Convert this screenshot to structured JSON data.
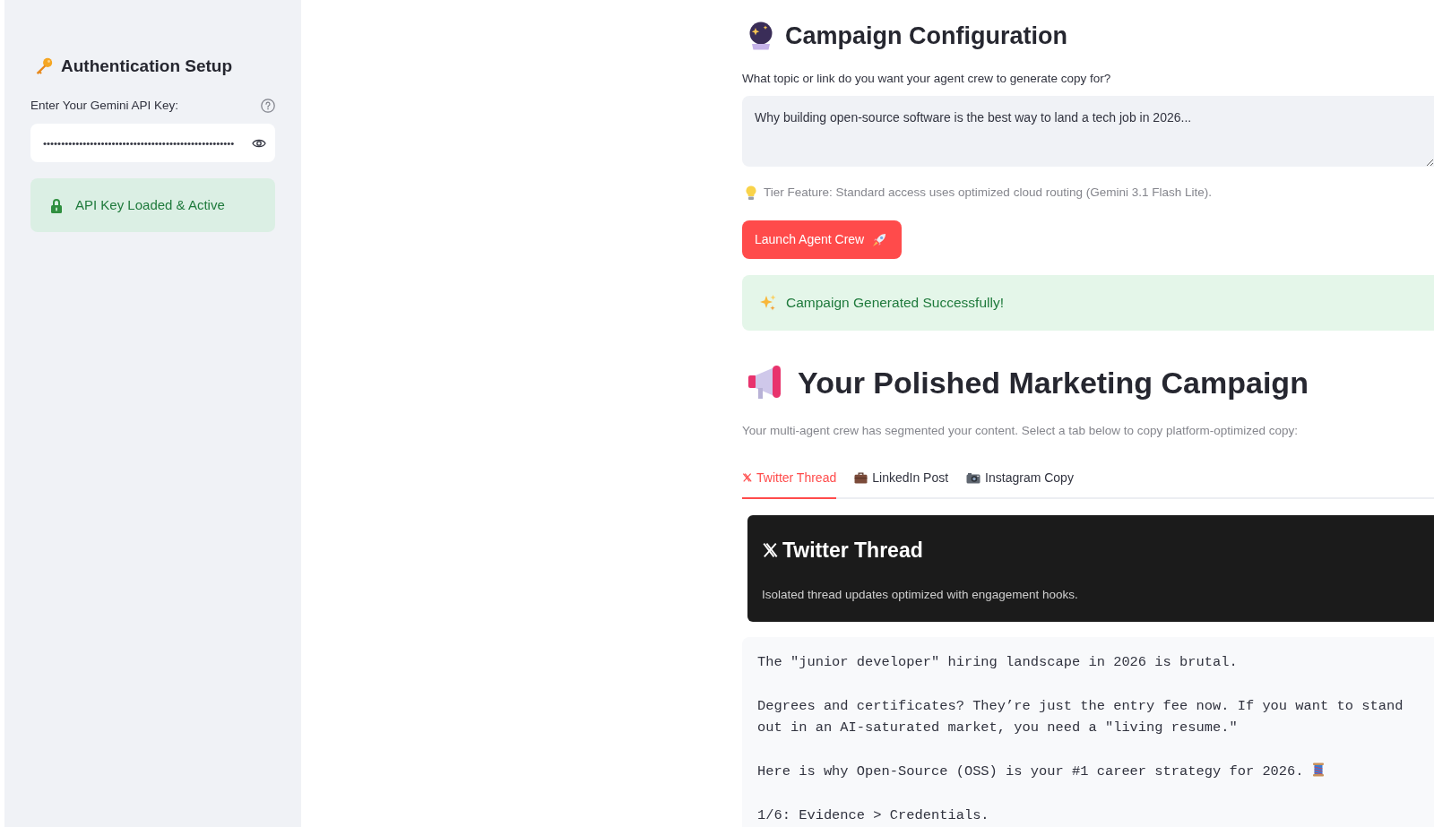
{
  "sidebar": {
    "title": "Authentication Setup",
    "api_key": {
      "label": "Enter Your Gemini API Key:",
      "value": "•••••••••••••••••••••••••••••••••••••••••••••••••••••"
    },
    "status": "API Key Loaded & Active"
  },
  "config": {
    "title": "Campaign Configuration",
    "topic": {
      "label": "What topic or link do you want your agent crew to generate copy for?",
      "value": "Why building open-source software is the best way to land a tech job in 2026..."
    },
    "tier_note": "Tier Feature: Standard access uses optimized cloud routing (Gemini 3.1 Flash Lite).",
    "launch_button": "Launch Agent Crew",
    "status": "Campaign Generated Successfully!"
  },
  "campaign": {
    "title": "Your Polished Marketing Campaign",
    "caption": "Your multi-agent crew has segmented your content. Select a tab below to copy platform-optimized copy:",
    "tabs": [
      {
        "label": "Twitter Thread",
        "selected": true
      },
      {
        "label": "LinkedIn Post",
        "selected": false
      },
      {
        "label": "Instagram Copy",
        "selected": false
      }
    ],
    "panel": {
      "title": "Twitter Thread",
      "subtitle": "Isolated thread updates optimized with engagement hooks.",
      "copy": [
        "The \"junior developer\" hiring landscape in 2026 is brutal.",
        "Degrees and certificates? They’re just the entry fee now. If you want to stand out in an AI-saturated market, you need a \"living resume.\"",
        "Here is why Open-Source (OSS) is your #1 career strategy for 2026.",
        "1/6: Evidence > Credentials."
      ]
    }
  }
}
